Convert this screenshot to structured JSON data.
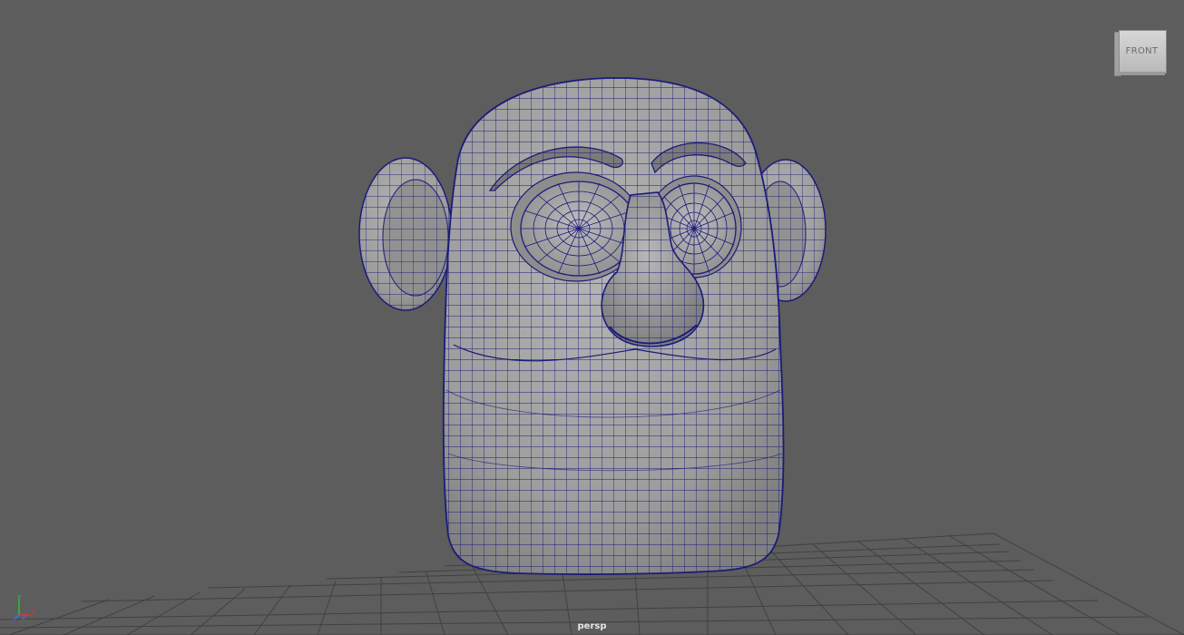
{
  "viewport": {
    "camera_name": "persp",
    "background": "#5d5d5d",
    "wireframe_color": "#1b1b7a",
    "grid_color": "#404040"
  },
  "view_cube": {
    "label": "FRONT"
  },
  "axis_indicator": {
    "x_label": "x",
    "y_label": "y",
    "z_label": "z"
  }
}
